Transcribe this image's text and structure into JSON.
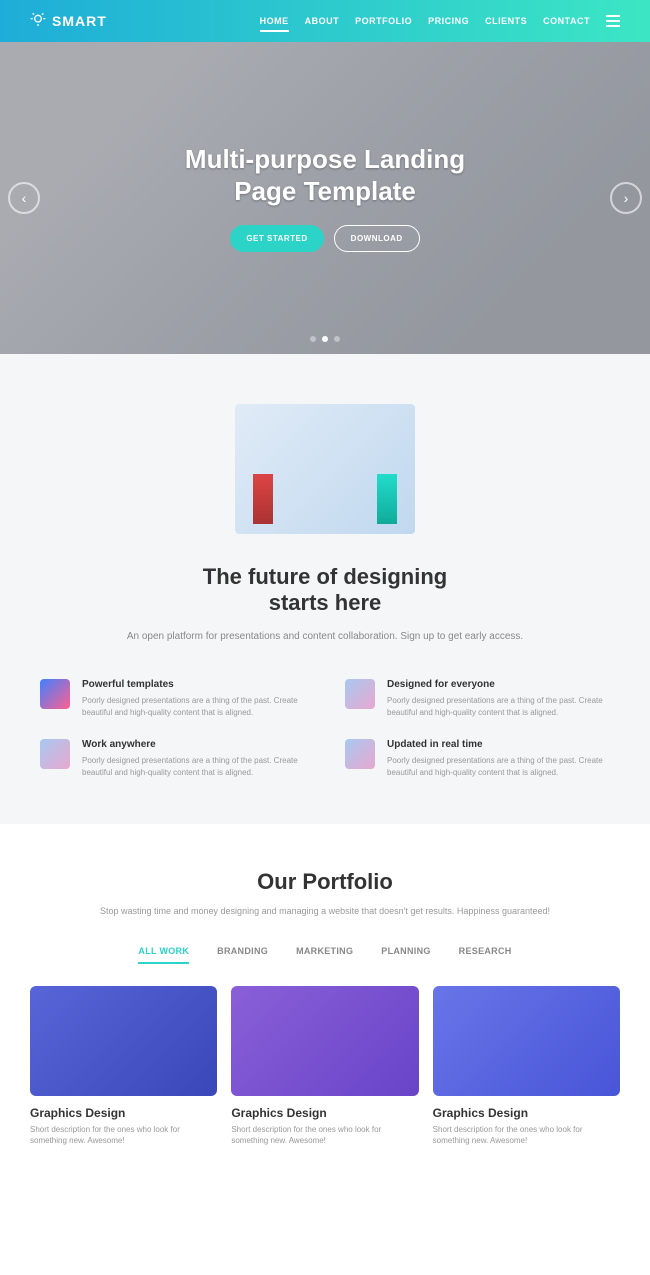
{
  "brand": "SMART",
  "nav": [
    "HOME",
    "ABOUT",
    "PORTFOLIO",
    "PRICING",
    "CLIENTS",
    "CONTACT"
  ],
  "hero": {
    "title_l1": "Multi-purpose Landing",
    "title_l2": "Page Template",
    "btn_primary": "GET STARTED",
    "btn_outline": "DOWNLOAD"
  },
  "about": {
    "title_l1": "The future of designing",
    "title_l2": "starts here",
    "sub": "An open platform for presentations and content collaboration. Sign up to get early access.",
    "features": [
      {
        "title": "Powerful templates",
        "desc": "Poorly designed presentations are a thing of the past. Create beautiful and high-quality content that is aligned."
      },
      {
        "title": "Designed for everyone",
        "desc": "Poorly designed presentations are a thing of the past. Create beautiful and high-quality content that is aligned."
      },
      {
        "title": "Work anywhere",
        "desc": "Poorly designed presentations are a thing of the past. Create beautiful and high-quality content that is aligned."
      },
      {
        "title": "Updated in real time",
        "desc": "Poorly designed presentations are a thing of the past. Create beautiful and high-quality content that is aligned."
      }
    ]
  },
  "portfolio": {
    "title": "Our Portfolio",
    "sub": "Stop wasting time and money designing and managing a website that doesn't get results. Happiness guaranteed!",
    "tabs": [
      "ALL WORK",
      "BRANDING",
      "MARKETING",
      "PLANNING",
      "RESEARCH"
    ],
    "cards": [
      {
        "title": "Graphics Design",
        "desc": "Short description for the ones who look for something new. Awesome!"
      },
      {
        "title": "Graphics Design",
        "desc": "Short description for the ones who look for something new. Awesome!"
      },
      {
        "title": "Graphics Design",
        "desc": "Short description for the ones who look for something new. Awesome!"
      }
    ]
  }
}
